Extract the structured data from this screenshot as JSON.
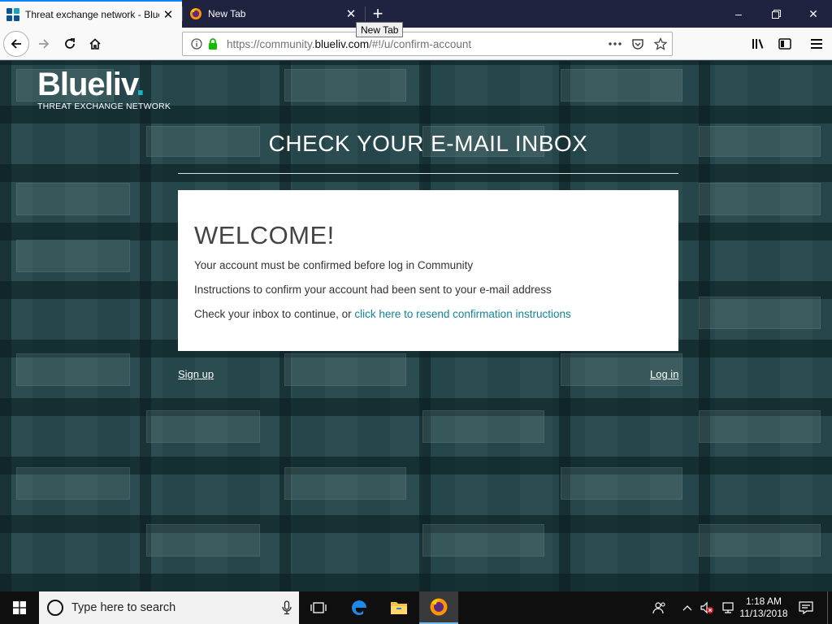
{
  "browser": {
    "tabs": [
      {
        "title": "Threat exchange network - Blue",
        "active": true
      },
      {
        "title": "New Tab",
        "active": false
      }
    ],
    "tooltip": "New Tab",
    "url": {
      "prefix": "https://community.",
      "host": "blueliv.com",
      "path": "/#!/u/confirm-account"
    }
  },
  "page": {
    "logo": {
      "word": "Blueliv",
      "dot": ".",
      "subtitle": "THREAT EXCHANGE NETWORK"
    },
    "heading": "CHECK YOUR E-MAIL INBOX",
    "card": {
      "title": "WELCOME!",
      "line1": "Your account must be confirmed before log in Community",
      "line2": "Instructions to confirm your account had been sent to your e-mail address",
      "line3_prefix": "Check your inbox to continue, or ",
      "line3_link": "click here to resend confirmation instructions"
    },
    "signup_label": "Sign up",
    "login_label": "Log in"
  },
  "taskbar": {
    "search_placeholder": "Type here to search",
    "time": "1:18 AM",
    "date": "11/13/2018"
  },
  "colors": {
    "accent_link": "#15849a",
    "brand_dot": "#19b3c6",
    "tab_active_indicator": "#0a84ff",
    "page_background": "#224448"
  }
}
